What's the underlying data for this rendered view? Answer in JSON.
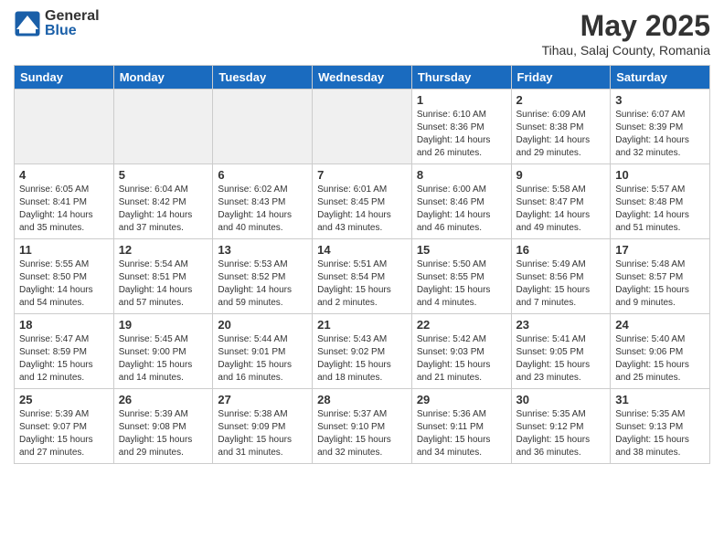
{
  "logo": {
    "general": "General",
    "blue": "Blue"
  },
  "title": "May 2025",
  "subtitle": "Tihau, Salaj County, Romania",
  "weekdays": [
    "Sunday",
    "Monday",
    "Tuesday",
    "Wednesday",
    "Thursday",
    "Friday",
    "Saturday"
  ],
  "weeks": [
    [
      {
        "day": "",
        "info": ""
      },
      {
        "day": "",
        "info": ""
      },
      {
        "day": "",
        "info": ""
      },
      {
        "day": "",
        "info": ""
      },
      {
        "day": "1",
        "info": "Sunrise: 6:10 AM\nSunset: 8:36 PM\nDaylight: 14 hours and 26 minutes."
      },
      {
        "day": "2",
        "info": "Sunrise: 6:09 AM\nSunset: 8:38 PM\nDaylight: 14 hours and 29 minutes."
      },
      {
        "day": "3",
        "info": "Sunrise: 6:07 AM\nSunset: 8:39 PM\nDaylight: 14 hours and 32 minutes."
      }
    ],
    [
      {
        "day": "4",
        "info": "Sunrise: 6:05 AM\nSunset: 8:41 PM\nDaylight: 14 hours and 35 minutes."
      },
      {
        "day": "5",
        "info": "Sunrise: 6:04 AM\nSunset: 8:42 PM\nDaylight: 14 hours and 37 minutes."
      },
      {
        "day": "6",
        "info": "Sunrise: 6:02 AM\nSunset: 8:43 PM\nDaylight: 14 hours and 40 minutes."
      },
      {
        "day": "7",
        "info": "Sunrise: 6:01 AM\nSunset: 8:45 PM\nDaylight: 14 hours and 43 minutes."
      },
      {
        "day": "8",
        "info": "Sunrise: 6:00 AM\nSunset: 8:46 PM\nDaylight: 14 hours and 46 minutes."
      },
      {
        "day": "9",
        "info": "Sunrise: 5:58 AM\nSunset: 8:47 PM\nDaylight: 14 hours and 49 minutes."
      },
      {
        "day": "10",
        "info": "Sunrise: 5:57 AM\nSunset: 8:48 PM\nDaylight: 14 hours and 51 minutes."
      }
    ],
    [
      {
        "day": "11",
        "info": "Sunrise: 5:55 AM\nSunset: 8:50 PM\nDaylight: 14 hours and 54 minutes."
      },
      {
        "day": "12",
        "info": "Sunrise: 5:54 AM\nSunset: 8:51 PM\nDaylight: 14 hours and 57 minutes."
      },
      {
        "day": "13",
        "info": "Sunrise: 5:53 AM\nSunset: 8:52 PM\nDaylight: 14 hours and 59 minutes."
      },
      {
        "day": "14",
        "info": "Sunrise: 5:51 AM\nSunset: 8:54 PM\nDaylight: 15 hours and 2 minutes."
      },
      {
        "day": "15",
        "info": "Sunrise: 5:50 AM\nSunset: 8:55 PM\nDaylight: 15 hours and 4 minutes."
      },
      {
        "day": "16",
        "info": "Sunrise: 5:49 AM\nSunset: 8:56 PM\nDaylight: 15 hours and 7 minutes."
      },
      {
        "day": "17",
        "info": "Sunrise: 5:48 AM\nSunset: 8:57 PM\nDaylight: 15 hours and 9 minutes."
      }
    ],
    [
      {
        "day": "18",
        "info": "Sunrise: 5:47 AM\nSunset: 8:59 PM\nDaylight: 15 hours and 12 minutes."
      },
      {
        "day": "19",
        "info": "Sunrise: 5:45 AM\nSunset: 9:00 PM\nDaylight: 15 hours and 14 minutes."
      },
      {
        "day": "20",
        "info": "Sunrise: 5:44 AM\nSunset: 9:01 PM\nDaylight: 15 hours and 16 minutes."
      },
      {
        "day": "21",
        "info": "Sunrise: 5:43 AM\nSunset: 9:02 PM\nDaylight: 15 hours and 18 minutes."
      },
      {
        "day": "22",
        "info": "Sunrise: 5:42 AM\nSunset: 9:03 PM\nDaylight: 15 hours and 21 minutes."
      },
      {
        "day": "23",
        "info": "Sunrise: 5:41 AM\nSunset: 9:05 PM\nDaylight: 15 hours and 23 minutes."
      },
      {
        "day": "24",
        "info": "Sunrise: 5:40 AM\nSunset: 9:06 PM\nDaylight: 15 hours and 25 minutes."
      }
    ],
    [
      {
        "day": "25",
        "info": "Sunrise: 5:39 AM\nSunset: 9:07 PM\nDaylight: 15 hours and 27 minutes."
      },
      {
        "day": "26",
        "info": "Sunrise: 5:39 AM\nSunset: 9:08 PM\nDaylight: 15 hours and 29 minutes."
      },
      {
        "day": "27",
        "info": "Sunrise: 5:38 AM\nSunset: 9:09 PM\nDaylight: 15 hours and 31 minutes."
      },
      {
        "day": "28",
        "info": "Sunrise: 5:37 AM\nSunset: 9:10 PM\nDaylight: 15 hours and 32 minutes."
      },
      {
        "day": "29",
        "info": "Sunrise: 5:36 AM\nSunset: 9:11 PM\nDaylight: 15 hours and 34 minutes."
      },
      {
        "day": "30",
        "info": "Sunrise: 5:35 AM\nSunset: 9:12 PM\nDaylight: 15 hours and 36 minutes."
      },
      {
        "day": "31",
        "info": "Sunrise: 5:35 AM\nSunset: 9:13 PM\nDaylight: 15 hours and 38 minutes."
      }
    ]
  ]
}
